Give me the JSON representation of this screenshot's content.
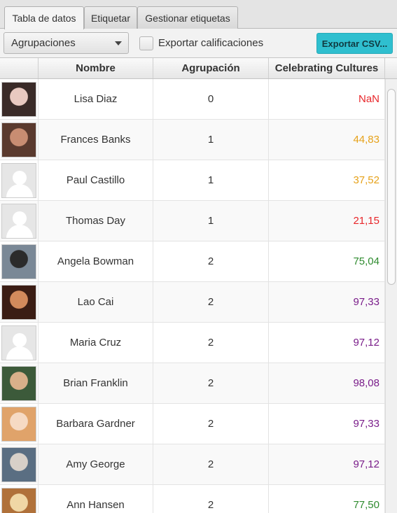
{
  "tabs": [
    {
      "label": "Tabla de datos"
    },
    {
      "label": "Etiquetar"
    },
    {
      "label": "Gestionar etiquetas"
    }
  ],
  "toolbar": {
    "combo_value": "Agrupaciones",
    "checkbox_label": "Exportar calificaciones",
    "export_label": "Exportar CSV..."
  },
  "table": {
    "columns": [
      "",
      "Nombre",
      "Agrupación",
      "Celebrating Cultures"
    ],
    "rows": [
      {
        "name": "Lisa Diaz",
        "group": "0",
        "grade": "NaN",
        "grade_color": "#e8262a",
        "avatar": "photo",
        "photo_colors": [
          "#3a2b28",
          "#e8c9c0"
        ]
      },
      {
        "name": "Frances Banks",
        "group": "1",
        "grade": "44,83",
        "grade_color": "#e6a21a",
        "avatar": "photo",
        "photo_colors": [
          "#5a3a2e",
          "#c88d72"
        ]
      },
      {
        "name": "Paul Castillo",
        "group": "1",
        "grade": "37,52",
        "grade_color": "#e6a21a",
        "avatar": "default"
      },
      {
        "name": "Thomas Day",
        "group": "1",
        "grade": "21,15",
        "grade_color": "#e8262a",
        "avatar": "default"
      },
      {
        "name": "Angela Bowman",
        "group": "2",
        "grade": "75,04",
        "grade_color": "#2e8b2e",
        "avatar": "photo",
        "photo_colors": [
          "#7a8896",
          "#2b2b2b"
        ]
      },
      {
        "name": "Lao Cai",
        "group": "2",
        "grade": "97,33",
        "grade_color": "#7a1d8a",
        "avatar": "photo",
        "photo_colors": [
          "#3b1d14",
          "#d28a5c"
        ]
      },
      {
        "name": "Maria Cruz",
        "group": "2",
        "grade": "97,12",
        "grade_color": "#7a1d8a",
        "avatar": "default"
      },
      {
        "name": "Brian Franklin",
        "group": "2",
        "grade": "98,08",
        "grade_color": "#7a1d8a",
        "avatar": "photo",
        "photo_colors": [
          "#3c5a3a",
          "#d9b08a"
        ]
      },
      {
        "name": "Barbara Gardner",
        "group": "2",
        "grade": "97,33",
        "grade_color": "#7a1d8a",
        "avatar": "photo",
        "photo_colors": [
          "#e0a36a",
          "#f6dac4"
        ]
      },
      {
        "name": "Amy George",
        "group": "2",
        "grade": "97,12",
        "grade_color": "#7a1d8a",
        "avatar": "photo",
        "photo_colors": [
          "#5a6e82",
          "#d8d0c8"
        ]
      },
      {
        "name": "Ann Hansen",
        "group": "2",
        "grade": "77,50",
        "grade_color": "#2e8b2e",
        "avatar": "photo",
        "photo_colors": [
          "#b0713a",
          "#f0d7a5"
        ]
      }
    ]
  },
  "icons": {
    "combo_arrow": "chevron-down-icon",
    "default_avatar": "user-silhouette-icon"
  }
}
